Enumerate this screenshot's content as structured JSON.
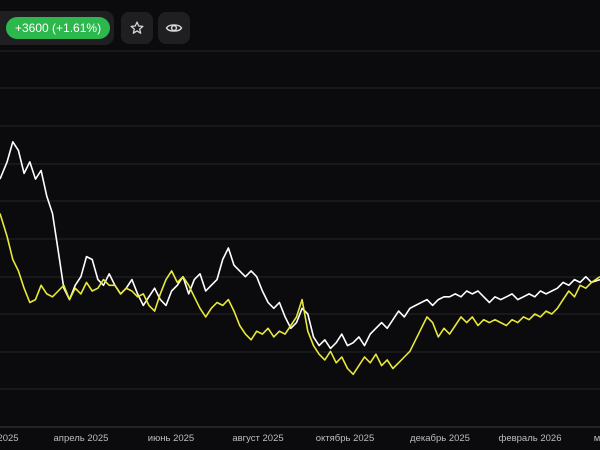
{
  "header": {
    "change_label": "+3600 (+1.61%)",
    "change_color": "#2db84d",
    "star_icon": "star-icon",
    "eye_icon": "eye-icon"
  },
  "chart_data": {
    "type": "line",
    "title": "",
    "xlabel": "",
    "ylabel": "",
    "grid": "horizontal",
    "background": "#0b0b0d",
    "x_tick_labels": [
      "2025",
      "апрель 2025",
      "июнь 2025",
      "август 2025",
      "октябрь 2025",
      "декабрь 2025",
      "февраль 2026",
      "м"
    ],
    "x_range": [
      "2025-02-01",
      "2026-03-31"
    ],
    "series": [
      {
        "color": "#ffffff",
        "points": [
          [
            "2025-02-01",
            70
          ],
          [
            "2025-02-06",
            76
          ],
          [
            "2025-02-10",
            83
          ],
          [
            "2025-02-14",
            80
          ],
          [
            "2025-02-18",
            72
          ],
          [
            "2025-02-22",
            76
          ],
          [
            "2025-02-26",
            70
          ],
          [
            "2025-03-02",
            73
          ],
          [
            "2025-03-06",
            64
          ],
          [
            "2025-03-10",
            58
          ],
          [
            "2025-03-14",
            45
          ],
          [
            "2025-03-18",
            32
          ],
          [
            "2025-03-22",
            28
          ],
          [
            "2025-03-26",
            33
          ],
          [
            "2025-03-30",
            36
          ],
          [
            "2025-04-03",
            43
          ],
          [
            "2025-04-07",
            42
          ],
          [
            "2025-04-11",
            35
          ],
          [
            "2025-04-15",
            33
          ],
          [
            "2025-04-19",
            37
          ],
          [
            "2025-04-23",
            33
          ],
          [
            "2025-04-27",
            30
          ],
          [
            "2025-05-01",
            32
          ],
          [
            "2025-05-05",
            35
          ],
          [
            "2025-05-09",
            30
          ],
          [
            "2025-05-13",
            26
          ],
          [
            "2025-05-17",
            29
          ],
          [
            "2025-05-21",
            32
          ],
          [
            "2025-05-25",
            28
          ],
          [
            "2025-05-29",
            26
          ],
          [
            "2025-06-02",
            31
          ],
          [
            "2025-06-06",
            33
          ],
          [
            "2025-06-10",
            36
          ],
          [
            "2025-06-14",
            30
          ],
          [
            "2025-06-18",
            35
          ],
          [
            "2025-06-22",
            37
          ],
          [
            "2025-06-26",
            31
          ],
          [
            "2025-06-30",
            33
          ],
          [
            "2025-07-04",
            35
          ],
          [
            "2025-07-08",
            42
          ],
          [
            "2025-07-12",
            46
          ],
          [
            "2025-07-16",
            40
          ],
          [
            "2025-07-20",
            38
          ],
          [
            "2025-07-24",
            36
          ],
          [
            "2025-07-28",
            38
          ],
          [
            "2025-08-01",
            36
          ],
          [
            "2025-08-05",
            31
          ],
          [
            "2025-08-09",
            27
          ],
          [
            "2025-08-13",
            25
          ],
          [
            "2025-08-17",
            27
          ],
          [
            "2025-08-21",
            22
          ],
          [
            "2025-08-25",
            18
          ],
          [
            "2025-08-29",
            20
          ],
          [
            "2025-09-02",
            25
          ],
          [
            "2025-09-06",
            23
          ],
          [
            "2025-09-10",
            15
          ],
          [
            "2025-09-14",
            12
          ],
          [
            "2025-09-18",
            14
          ],
          [
            "2025-09-22",
            11
          ],
          [
            "2025-09-26",
            13
          ],
          [
            "2025-09-30",
            16
          ],
          [
            "2025-10-04",
            12
          ],
          [
            "2025-10-08",
            13
          ],
          [
            "2025-10-12",
            15
          ],
          [
            "2025-10-16",
            12
          ],
          [
            "2025-10-20",
            16
          ],
          [
            "2025-10-24",
            18
          ],
          [
            "2025-10-28",
            20
          ],
          [
            "2025-11-01",
            18
          ],
          [
            "2025-11-05",
            21
          ],
          [
            "2025-11-09",
            24
          ],
          [
            "2025-11-13",
            22
          ],
          [
            "2025-11-17",
            25
          ],
          [
            "2025-11-21",
            26
          ],
          [
            "2025-11-25",
            27
          ],
          [
            "2025-11-29",
            28
          ],
          [
            "2025-12-03",
            26
          ],
          [
            "2025-12-07",
            28
          ],
          [
            "2025-12-11",
            29
          ],
          [
            "2025-12-15",
            29
          ],
          [
            "2025-12-19",
            30
          ],
          [
            "2025-12-23",
            29
          ],
          [
            "2025-12-27",
            31
          ],
          [
            "2025-12-31",
            30
          ],
          [
            "2026-01-04",
            31
          ],
          [
            "2026-01-08",
            29
          ],
          [
            "2026-01-12",
            27
          ],
          [
            "2026-01-16",
            29
          ],
          [
            "2026-01-20",
            28
          ],
          [
            "2026-01-24",
            29
          ],
          [
            "2026-01-28",
            30
          ],
          [
            "2026-02-01",
            28
          ],
          [
            "2026-02-05",
            29
          ],
          [
            "2026-02-09",
            30
          ],
          [
            "2026-02-13",
            29
          ],
          [
            "2026-02-17",
            31
          ],
          [
            "2026-02-21",
            30
          ],
          [
            "2026-02-25",
            31
          ],
          [
            "2026-03-01",
            32
          ],
          [
            "2026-03-05",
            34
          ],
          [
            "2026-03-09",
            33
          ],
          [
            "2026-03-13",
            35
          ],
          [
            "2026-03-17",
            34
          ],
          [
            "2026-03-21",
            36
          ],
          [
            "2026-03-25",
            34
          ],
          [
            "2026-03-31",
            35
          ]
        ]
      },
      {
        "color": "#e8e83a",
        "points": [
          [
            "2025-02-01",
            58
          ],
          [
            "2025-02-06",
            50
          ],
          [
            "2025-02-10",
            42
          ],
          [
            "2025-02-14",
            38
          ],
          [
            "2025-02-18",
            32
          ],
          [
            "2025-02-22",
            27
          ],
          [
            "2025-02-26",
            28
          ],
          [
            "2025-03-02",
            33
          ],
          [
            "2025-03-06",
            30
          ],
          [
            "2025-03-10",
            29
          ],
          [
            "2025-03-14",
            31
          ],
          [
            "2025-03-18",
            33
          ],
          [
            "2025-03-22",
            28
          ],
          [
            "2025-03-26",
            32
          ],
          [
            "2025-03-30",
            30
          ],
          [
            "2025-04-03",
            34
          ],
          [
            "2025-04-07",
            31
          ],
          [
            "2025-04-11",
            32
          ],
          [
            "2025-04-15",
            35
          ],
          [
            "2025-04-19",
            33
          ],
          [
            "2025-04-23",
            33
          ],
          [
            "2025-04-27",
            30
          ],
          [
            "2025-05-01",
            32
          ],
          [
            "2025-05-05",
            31
          ],
          [
            "2025-05-09",
            29
          ],
          [
            "2025-05-13",
            30
          ],
          [
            "2025-05-17",
            26
          ],
          [
            "2025-05-21",
            24
          ],
          [
            "2025-05-25",
            30
          ],
          [
            "2025-05-29",
            35
          ],
          [
            "2025-06-02",
            38
          ],
          [
            "2025-06-06",
            34
          ],
          [
            "2025-06-10",
            36
          ],
          [
            "2025-06-14",
            33
          ],
          [
            "2025-06-18",
            29
          ],
          [
            "2025-06-22",
            25
          ],
          [
            "2025-06-26",
            22
          ],
          [
            "2025-06-30",
            25
          ],
          [
            "2025-07-04",
            27
          ],
          [
            "2025-07-08",
            26
          ],
          [
            "2025-07-12",
            28
          ],
          [
            "2025-07-16",
            24
          ],
          [
            "2025-07-20",
            19
          ],
          [
            "2025-07-24",
            16
          ],
          [
            "2025-07-28",
            14
          ],
          [
            "2025-08-01",
            17
          ],
          [
            "2025-08-05",
            16
          ],
          [
            "2025-08-09",
            18
          ],
          [
            "2025-08-13",
            15
          ],
          [
            "2025-08-17",
            17
          ],
          [
            "2025-08-21",
            16
          ],
          [
            "2025-08-25",
            19
          ],
          [
            "2025-08-29",
            22
          ],
          [
            "2025-09-02",
            28
          ],
          [
            "2025-09-06",
            17
          ],
          [
            "2025-09-10",
            12
          ],
          [
            "2025-09-14",
            9
          ],
          [
            "2025-09-18",
            7
          ],
          [
            "2025-09-22",
            10
          ],
          [
            "2025-09-26",
            6
          ],
          [
            "2025-09-30",
            8
          ],
          [
            "2025-10-04",
            4
          ],
          [
            "2025-10-08",
            2
          ],
          [
            "2025-10-12",
            5
          ],
          [
            "2025-10-16",
            8
          ],
          [
            "2025-10-20",
            6
          ],
          [
            "2025-10-24",
            9
          ],
          [
            "2025-10-28",
            5
          ],
          [
            "2025-11-01",
            7
          ],
          [
            "2025-11-05",
            4
          ],
          [
            "2025-11-09",
            6
          ],
          [
            "2025-11-13",
            8
          ],
          [
            "2025-11-17",
            10
          ],
          [
            "2025-11-21",
            14
          ],
          [
            "2025-11-25",
            18
          ],
          [
            "2025-11-29",
            22
          ],
          [
            "2025-12-03",
            20
          ],
          [
            "2025-12-07",
            15
          ],
          [
            "2025-12-11",
            18
          ],
          [
            "2025-12-15",
            16
          ],
          [
            "2025-12-19",
            19
          ],
          [
            "2025-12-23",
            22
          ],
          [
            "2025-12-27",
            20
          ],
          [
            "2025-12-31",
            22
          ],
          [
            "2026-01-04",
            19
          ],
          [
            "2026-01-08",
            21
          ],
          [
            "2026-01-12",
            20
          ],
          [
            "2026-01-16",
            21
          ],
          [
            "2026-01-20",
            20
          ],
          [
            "2026-01-24",
            19
          ],
          [
            "2026-01-28",
            21
          ],
          [
            "2026-02-01",
            20
          ],
          [
            "2026-02-05",
            22
          ],
          [
            "2026-02-09",
            21
          ],
          [
            "2026-02-13",
            23
          ],
          [
            "2026-02-17",
            22
          ],
          [
            "2026-02-21",
            24
          ],
          [
            "2026-02-25",
            23
          ],
          [
            "2026-03-01",
            25
          ],
          [
            "2026-03-05",
            28
          ],
          [
            "2026-03-09",
            31
          ],
          [
            "2026-03-13",
            29
          ],
          [
            "2026-03-17",
            33
          ],
          [
            "2026-03-21",
            32
          ],
          [
            "2026-03-25",
            34
          ],
          [
            "2026-03-31",
            36
          ]
        ]
      }
    ]
  }
}
